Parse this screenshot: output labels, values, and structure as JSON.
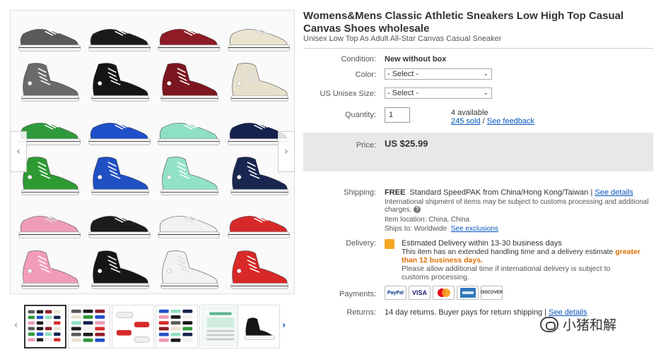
{
  "listing": {
    "title": "Womens&Mens Classic Athletic Sneakers Low High Top Casual Canvas Shoes wholesale",
    "subtitle": "Unisex Low Top As Adult All-Star Canvas Casual Sneaker"
  },
  "gallery": {
    "prev_glyph": "‹",
    "next_glyph": "›",
    "thumb_prev_glyph": "‹",
    "thumb_next_glyph": "›",
    "shoes": [
      {
        "color": "#5a5a5a",
        "style": "low"
      },
      {
        "color": "#1a1a1a",
        "style": "low"
      },
      {
        "color": "#8e1b26",
        "style": "low"
      },
      {
        "color": "#e9e3d0",
        "style": "low"
      },
      {
        "color": "#6a6a6a",
        "style": "high"
      },
      {
        "color": "#151515",
        "style": "high"
      },
      {
        "color": "#7c1620",
        "style": "high"
      },
      {
        "color": "#e6e0cc",
        "style": "high"
      },
      {
        "color": "#2f9a3c",
        "style": "low"
      },
      {
        "color": "#1f4fc9",
        "style": "low"
      },
      {
        "color": "#8ee0c2",
        "style": "low"
      },
      {
        "color": "#14224e",
        "style": "low"
      },
      {
        "color": "#2e9a32",
        "style": "high"
      },
      {
        "color": "#2150c4",
        "style": "high"
      },
      {
        "color": "#92e2c6",
        "style": "high"
      },
      {
        "color": "#182650",
        "style": "high"
      },
      {
        "color": "#ee9bb9",
        "style": "low"
      },
      {
        "color": "#1c1c1c",
        "style": "low"
      },
      {
        "color": "#f1f1f1",
        "style": "low"
      },
      {
        "color": "#d62a2a",
        "style": "low"
      },
      {
        "color": "#f29bbb",
        "style": "high"
      },
      {
        "color": "#161616",
        "style": "high"
      },
      {
        "color": "#f3f3f3",
        "style": "high"
      },
      {
        "color": "#d82828",
        "style": "high"
      }
    ],
    "thumbnails": [
      {
        "name": "thumb-grid-all",
        "kind": "grid"
      },
      {
        "name": "thumb-grid-colors",
        "kind": "grid2"
      },
      {
        "name": "thumb-white-red",
        "kind": "pair"
      },
      {
        "name": "thumb-grid-dark",
        "kind": "grid3"
      },
      {
        "name": "thumb-size-chart",
        "kind": "chart"
      },
      {
        "name": "thumb-black-high",
        "kind": "single"
      }
    ]
  },
  "details": {
    "condition_label": "Condition:",
    "condition_value": "New without box",
    "color_label": "Color:",
    "color_select": "- Select -",
    "size_label": "US Unisex Size:",
    "size_select": "- Select -",
    "quantity_label": "Quantity:",
    "quantity_value": "1",
    "available": "4 available",
    "sold": "245 sold",
    "separator": " / ",
    "feedback": "See feedback",
    "price_label": "Price:",
    "price_value": "US $25.99",
    "shipping_label": "Shipping:",
    "shipping_free": "FREE",
    "shipping_method": "Standard SpeedPAK from China/Hong Kong/Taiwan",
    "pipe": " | ",
    "see_details": "See details",
    "shipping_note": "International shipment of items may be subject to customs processing and additional",
    "shipping_note2": "charges.",
    "item_location": "Item location:  China, China",
    "ships_to": "Ships to:  Worldwide",
    "see_exclusions": "See exclusions",
    "delivery_label": "Delivery:",
    "delivery_estimate": "Estimated Delivery within 13-30 business days",
    "delivery_line1": "This item has an extended handling time and a delivery estimate ",
    "delivery_greater": "greater",
    "delivery_than": "than 12 business days.",
    "delivery_note1": "Please allow additional time if international delivery is subject to",
    "delivery_note2": "customs processing.",
    "payments_label": "Payments:",
    "payment_methods": [
      "PayPal",
      "VISA",
      "MC",
      "AMEX",
      "DISCOVER"
    ],
    "returns_label": "Returns:",
    "returns_value": "14 day returns. Buyer pays for return shipping",
    "returns_pipe": " | ",
    "returns_details": "See details"
  },
  "watermark": {
    "text": "小猪和解"
  },
  "colors": {
    "link": "#0654ba",
    "price_bg": "#e8e8e8",
    "orange": "#dd6e00"
  }
}
